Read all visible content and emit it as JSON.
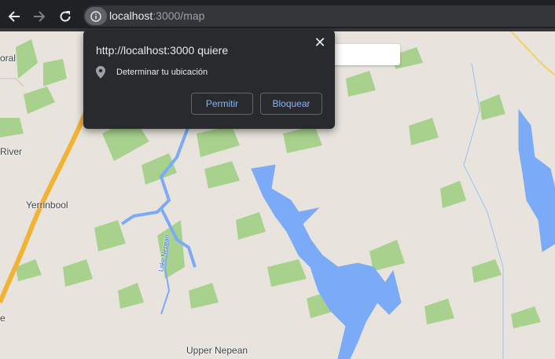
{
  "browser": {
    "url_host": "localhost",
    "url_rest": ":3000/map",
    "back_icon": "arrow-left-icon",
    "forward_icon": "arrow-right-icon",
    "reload_icon": "reload-icon",
    "site_info_icon": "info-icon"
  },
  "permission_prompt": {
    "title": "http://localhost:3000 quiere",
    "permission_text": "Determinar tu ubicación",
    "permission_icon": "location-pin-icon",
    "allow_label": "Permitir",
    "block_label": "Bloquear",
    "close_symbol": "✕"
  },
  "map": {
    "labels": [
      "oral",
      "River",
      "Yerrinbool",
      "Lake Nepean",
      "Upper Nepean",
      "e"
    ],
    "colors": {
      "land": "#e8e4dd",
      "water": "#7baaf7",
      "park": "#a8d18d",
      "highway": "#f2b233"
    }
  }
}
